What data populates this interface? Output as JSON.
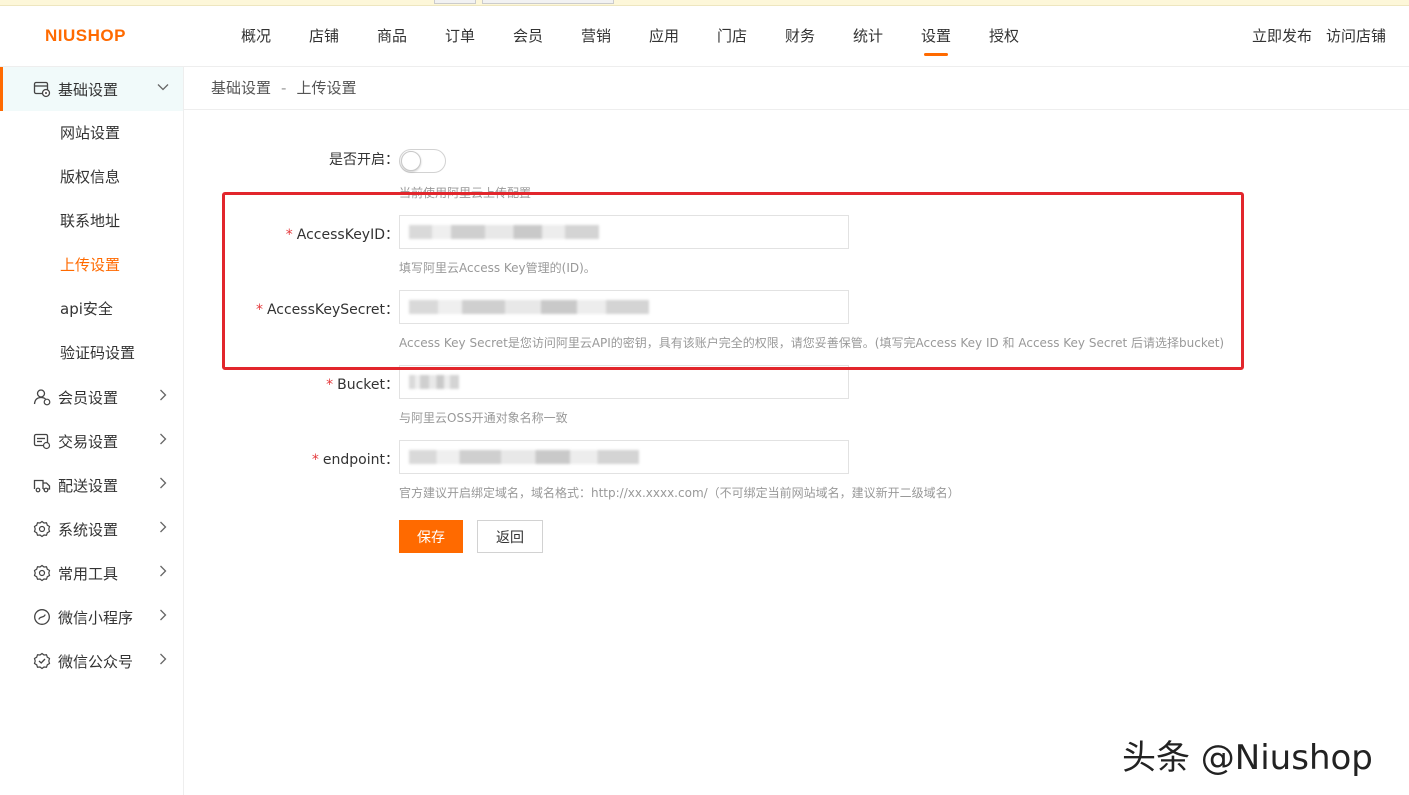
{
  "header": {
    "logo": "NIUSHOP",
    "nav": [
      "概况",
      "店铺",
      "商品",
      "订单",
      "会员",
      "营销",
      "应用",
      "门店",
      "财务",
      "统计",
      "设置",
      "授权"
    ],
    "active_nav": "设置",
    "right_links": [
      "立即发布",
      "访问店铺"
    ],
    "accent_color": "#ff6a00"
  },
  "sidebar": {
    "groups": [
      {
        "label": "基础设置",
        "icon": "basic-settings-icon",
        "open": true,
        "items": [
          "网站设置",
          "版权信息",
          "联系地址",
          "上传设置",
          "api安全",
          "验证码设置"
        ],
        "active_item": "上传设置"
      },
      {
        "label": "会员设置",
        "icon": "member-icon"
      },
      {
        "label": "交易设置",
        "icon": "trade-icon"
      },
      {
        "label": "配送设置",
        "icon": "delivery-icon"
      },
      {
        "label": "系统设置",
        "icon": "gear-icon"
      },
      {
        "label": "常用工具",
        "icon": "tools-icon"
      },
      {
        "label": "微信小程序",
        "icon": "miniprogram-icon"
      },
      {
        "label": "微信公众号",
        "icon": "wechat-official-icon"
      }
    ]
  },
  "breadcrumb": {
    "parent": "基础设置",
    "separator": "-",
    "current": "上传设置"
  },
  "form": {
    "enable": {
      "label": "是否开启：",
      "hint": "当前使用阿里云上传配置",
      "on": false
    },
    "access_key_id": {
      "required": "*",
      "label": "AccessKeyID：",
      "hint": "填写阿里云Access Key管理的(ID)。"
    },
    "access_key_secret": {
      "required": "*",
      "label": "AccessKeySecret：",
      "hint": "Access Key Secret是您访问阿里云API的密钥，具有该账户完全的权限，请您妥善保管。(填写完Access Key ID 和 Access Key Secret 后请选择bucket)"
    },
    "bucket": {
      "required": "*",
      "label": "Bucket：",
      "hint": "与阿里云OSS开通对象名称一致"
    },
    "endpoint": {
      "required": "*",
      "label": "endpoint：",
      "hint": "官方建议开启绑定域名，域名格式：http://xx.xxxx.com/（不可绑定当前网站域名，建议新开二级域名）"
    },
    "save_label": "保存",
    "back_label": "返回"
  },
  "highlight_color": "#e2262c",
  "watermark": "头条 @Niushop"
}
